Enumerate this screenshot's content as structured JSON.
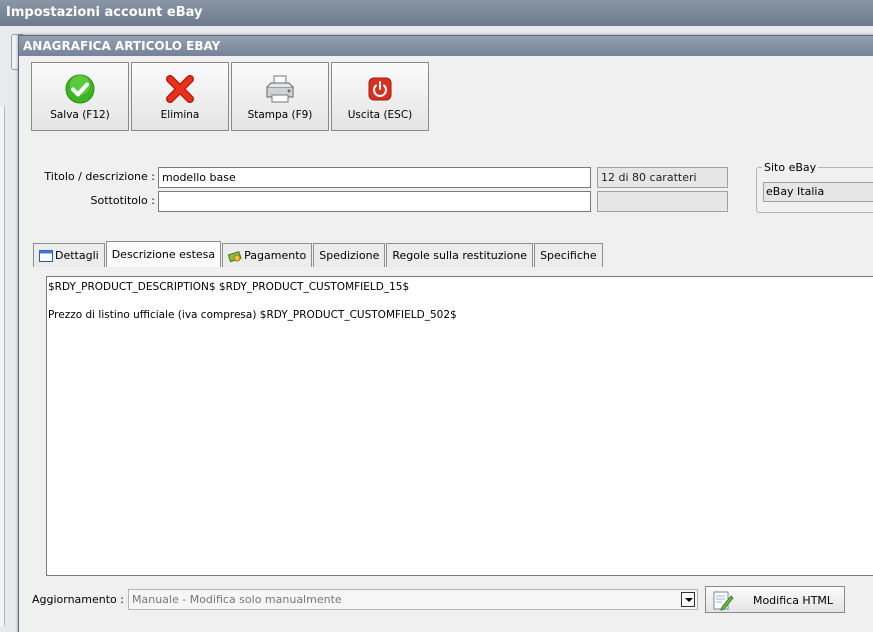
{
  "outer_window": {
    "title": "Impostazioni account eBay"
  },
  "dialog": {
    "title": "ANAGRAFICA ARTICOLO EBAY"
  },
  "toolbar": {
    "save_label": "Salva (F12)",
    "delete_label": "Elimina",
    "print_label": "Stampa (F9)",
    "exit_label": "Uscita (ESC)"
  },
  "form": {
    "title_label": "Titolo / descrizione :",
    "title_value": "modello base",
    "char_count": "12 di 80 caratteri",
    "subtitle_label": "Sottotitolo :",
    "subtitle_value": "",
    "site_group_label": "Sito eBay",
    "site_value": "eBay Italia"
  },
  "tabs": [
    {
      "label": "Dettagli",
      "icon": "window-icon"
    },
    {
      "label": "Descrizione estesa",
      "active": true
    },
    {
      "label": "Pagamento",
      "icon": "money-icon"
    },
    {
      "label": "Spedizione"
    },
    {
      "label": "Regole sulla restituzione"
    },
    {
      "label": "Specifiche"
    }
  ],
  "editor": {
    "lines": [
      "$RDY_PRODUCT_DESCRIPTION$ $RDY_PRODUCT_CUSTOMFIELD_15$",
      "",
      "Prezzo di listino ufficiale (iva compresa) $RDY_PRODUCT_CUSTOMFIELD_502$"
    ]
  },
  "update": {
    "label": "Aggiornamento :",
    "selected": "Manuale - Modifica solo manualmente",
    "edit_html_label": "Modifica HTML"
  },
  "colors": {
    "titlebar": "#75839a",
    "save_green": "#3cb521",
    "delete_red": "#e8301c",
    "exit_red": "#d9301f"
  }
}
